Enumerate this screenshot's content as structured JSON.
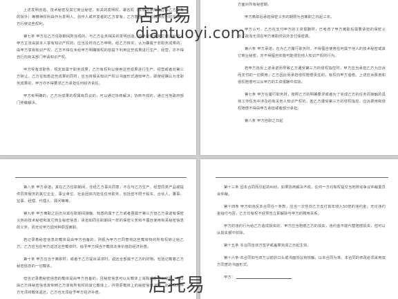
{
  "pages": {
    "top_left": {
      "paragraphs": [
        "上述发明创造、技术秘密及其它商业秘密，有关的发明权、署名权（依照法律规定应由乙方享有的除外）等精神权利由作为发明人、创作人或开发者的乙方享有，乙方尊重甲方的精神权利并协助甲方行使这些权利。",
        "第七条 甲方在乙方任职期间所完成的、与乙方业务相关的发明创造、技术秘密或其它商业秘密，甲方主张由其本人享有知识产权的，应当及时向乙方申明，经乙方核实，认为确属于非职务成果的，由甲方享有知识产权，乙方不得在未经甲方明确授权的前提下利用这些成果进行生产、经营，亦不得自行向有关部门申请知识产权。",
        "甲方受有非职务，规定其属于职务成果，乙方有权利以使用这些成果进行生产、经营或者向第三方转让。乙方在知悉这些成果的同时，应当将相关知识产权以书面形式通知甲方，即使经确认为非职务成果的，甲方亦不得要求乙方承担任何经济责任。",
        "甲方有明确的，乙方对成果的权属有异议的，可以通过协商解决；协商不成的，通过当地政府部门仲裁解决。"
      ]
    },
    "top_right": {
      "paragraphs": [
        "方面对所有秘密期。",
        "甲方离职后承担保密义务的期限为自离职之日起三年。",
        "甲方认可，乙方在支付甲方的工资报酬时，已考虑了甲方离职后需要承担的保密义务，故而无须在甲方离职时另外支付保密费。",
        "第六条 甲方承诺，在为乙方履行职务时，不得擅自使用任何属于他人的技术秘密或其它商业秘密，亦不得擅自实施可能侵犯他人知识产权的行为。",
        "若甲方违反上述承诺而导致乙方遭受第三方的侵权指控时，甲方应当承担乙方为应诉而支付的一切费用；乙方因此而承担侵权赔偿责任的，有权向甲方追偿。上述应诉费用和侵权赔偿可以从甲方的工资报酬中扣除。",
        "第七条 甲方在履行职务时，按照乙方的明确要求或者为了完成乙方的任务而接触的具体工作任务中涉及的有关他人知识产权的，若乙方遭受第三方的侵权指控，应诉费用和侵权赔偿不得由甲方承担或者部分承担。",
        "第八条 甲方自职之日起"
      ]
    },
    "bottom_left": {
      "paragraphs": [
        "第八条 甲方承诺，其在乙方任职期间，非经乙方事先同意，不在与乙方生产、经营同类产品或提供同类服务的其它企业、事业单位、社会团体内担任任何职务，包括但不限于股东、合伙人、董事、监事、经理、代理人、顾问等等。",
        "第九条 甲方离职之后仍对其在职期间接触、知悉的属于乙方或者虽属于第三方但乙方承诺有保密义务的技术秘密和其它商业秘密信息，承担如同任职期间一样的保密义务和不擅自使用有关秘密信息的义务，而无论甲方因何种原因离职。",
        "若记录着秘密信息的载体是由甲方自备的，则视为甲方已同意将这些载体物的所有权转让给乙方。乙方应当在甲方返还这些载体时，给予甲方相当于载体本身价值的经济补偿。",
        "第十条 甲方应当于离职时，或者于乙方提出请求时，返还全部属于乙方的财物，包括记载着乙方秘密信息的一切载体。",
        "但当记录着秘密信息的载体是由甲方自备的，且秘密信息可以从载体上消除或复制出来时，可以由乙方将秘密信息复制到乙方享有所有权的其它载体上，并把原载体上的秘密信息消除。此种情况甲方无须将载体返还，乙方也无须给予甲方经济补偿。"
      ]
    },
    "bottom_right": {
      "paragraphs": [
        "第十三条 因本合同而引起的纠纷，如果协商解决不成，任何一方均有权提交当地劳动争议仲裁委员会仲裁。",
        "第十四条 甲方如违反本合同任一条款，应当一次性向乙方支付其年收入50倍的违约金；无论违约金给付与否，乙方均有权不经预告立即解除与甲方的聘用关系。",
        "甲方的违约行为给乙方造成损失的，甲方应当赔偿乙方的损失，违约金不能代替赔偿损失，但可以从损失额中扣除。",
        "第十五条 本合同自双方签字或盖章完成之日起生效。",
        "第十六条 本合同如与双方以前的口头或书面协议有抵触，以本合同为准。本合同的修改必须采用双方同意的书面形式。",
        "甲方："
      ]
    }
  },
  "watermark": {
    "cn": "店托易",
    "url": "diantuoyi.com"
  }
}
